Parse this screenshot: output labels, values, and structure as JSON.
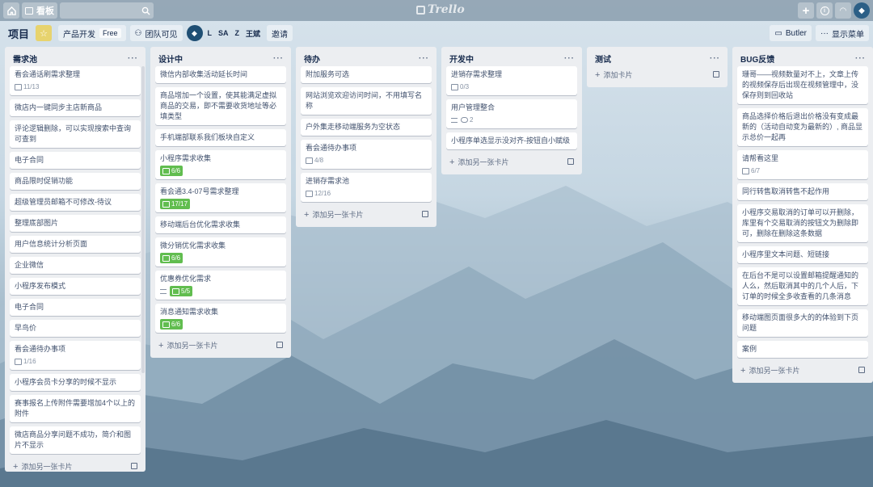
{
  "app": {
    "logo_text": "Trello"
  },
  "topbar": {
    "home_icon": "home-icon",
    "boards_label": "看板",
    "search_placeholder": ""
  },
  "board": {
    "title": "项目",
    "team_label": "产品开发",
    "team_badge": "Free",
    "visibility_label": "团队可见",
    "members": [
      "L",
      "SA",
      "Z",
      "王斌"
    ],
    "invite_label": "邀请",
    "butler_label": "Butler",
    "menu_label": "显示菜单"
  },
  "lists": [
    {
      "title": "需求池",
      "add_label": "添加另一张卡片",
      "cards": [
        {
          "text": "看会通话刷需求整理",
          "checklist": "11/13"
        },
        {
          "text": "微店内一键同步主店新商品"
        },
        {
          "text": "评论逻辑删除，可以实现搜索中查询可查到"
        },
        {
          "text": "电子合同"
        },
        {
          "text": "商品限时促销功能"
        },
        {
          "text": "超级管理员邮箱不可修改-待议"
        },
        {
          "text": "整理底部图片"
        },
        {
          "text": "用户信息统计分析页面"
        },
        {
          "text": "企业微信"
        },
        {
          "text": "小程序发布模式"
        },
        {
          "text": "电子合同"
        },
        {
          "text": "早鸟价"
        },
        {
          "text": "看会通待办事项",
          "checklist": "1/16"
        },
        {
          "text": "小程序会员卡分享的时候不显示"
        },
        {
          "text": "赛事报名上传附件需要增加4个以上的附件"
        },
        {
          "text": "微店商品分享问题不成功，简介和图片不显示"
        }
      ]
    },
    {
      "title": "设计中",
      "add_label": "添加另一张卡片",
      "cards": [
        {
          "text": "微信内部收集活动延长时间"
        },
        {
          "text": "商品增加一个设置，使其能满足虚拟商品的交易，即不需要收货地址等必填类型"
        },
        {
          "text": "手机端部联系我们板块自定义"
        },
        {
          "text": "小程序需求收集",
          "checklist_green": "6/6"
        },
        {
          "text": "看会通3.4-07号需求整理",
          "checklist_green": "17/17"
        },
        {
          "text": "移动端后台优化需求收集"
        },
        {
          "text": "微分销优化需求收集",
          "checklist_green": "6/6"
        },
        {
          "text": "优惠券优化需求",
          "description": true,
          "checklist_green": "5/5"
        },
        {
          "text": "消息通知需求收集",
          "checklist_green": "6/6"
        }
      ]
    },
    {
      "title": "待办",
      "add_label": "添加另一张卡片",
      "cards": [
        {
          "text": "附加服务可选"
        },
        {
          "text": "网站浏览欢迎访问时间，不用填写名称"
        },
        {
          "text": "户外集走移动端服务为空状态"
        },
        {
          "text": "看会通待办事项",
          "checklist": "4/8"
        },
        {
          "text": "进销存需求池",
          "checklist": "12/16"
        }
      ]
    },
    {
      "title": "开发中",
      "add_label": "添加另一张卡片",
      "cards": [
        {
          "text": "进销存需求整理",
          "checklist": "0/3"
        },
        {
          "text": "用户管理整合",
          "description": true,
          "comments": "2"
        },
        {
          "text": "小程序单选显示没对齐-按钮自小赋级"
        }
      ]
    },
    {
      "title": "测试",
      "add_label": "添加卡片",
      "cards": []
    },
    {
      "title": "BUG反馈",
      "add_label": "添加另一张卡片",
      "cards": [
        {
          "text": "珊哥——视频数量对不上，文章上传的视频保存后出现在视频管理中，没保存则到回收站"
        },
        {
          "text": "商品选择价格后退出价格没有变成最新的（活动自动变为最新的）, 商品显示总价一起再"
        },
        {
          "text": "请帮看这里",
          "checklist": "6/7"
        },
        {
          "text": "同行转售取消转售不起作用"
        },
        {
          "text": "小程序交易取消的订单可以开删除，库里有个交易取消的按钮文为删除即可，删除在删除这条数据"
        },
        {
          "text": "小程序里文本问题、短链接"
        },
        {
          "text": "在后台不是可以设置邮箱提醒通知的人么，然后取消其中的几个人后，下订单的时候全多收查看的几条消息"
        },
        {
          "text": "移动端图页面很多大的的体验到下页问题"
        },
        {
          "text": "案例"
        }
      ]
    }
  ]
}
